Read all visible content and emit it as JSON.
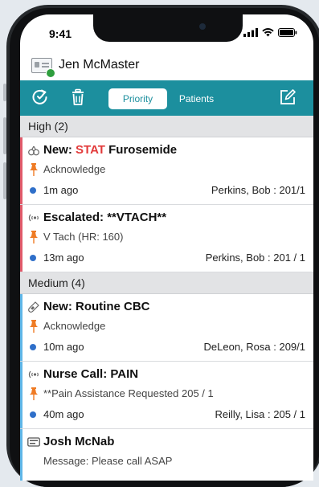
{
  "status": {
    "time": "9:41"
  },
  "user": {
    "name": "Jen McMaster"
  },
  "toolbar": {
    "tab_priority": "Priority",
    "tab_patients": "Patients"
  },
  "sections": [
    {
      "label": "High (2)"
    },
    {
      "label": "Medium (4)"
    }
  ],
  "items": [
    {
      "title_prefix": "New: ",
      "title_highlight": "STAT",
      "title_rest": " Furosemide",
      "subtitle": "Acknowledge",
      "time": "1m ago",
      "patient": "Perkins, Bob : 201/1",
      "icon": "lab-flask-icon"
    },
    {
      "title": "Escalated: **VTACH**",
      "subtitle": "V Tach (HR: 160)",
      "time": "13m ago",
      "patient": "Perkins, Bob : 201 / 1",
      "icon": "alarm-signal-icon"
    },
    {
      "title": "New: Routine CBC",
      "subtitle": "Acknowledge",
      "time": "10m ago",
      "patient": "DeLeon, Rosa : 209/1",
      "icon": "test-tube-icon"
    },
    {
      "title": "Nurse Call: PAIN",
      "subtitle": "**Pain Assistance Requested 205 / 1",
      "time": "40m ago",
      "patient": "Reilly, Lisa : 205 / 1",
      "icon": "alarm-signal-icon"
    },
    {
      "title": "Josh McNab",
      "subtitle": "Message: Please call ASAP",
      "icon": "message-card-icon"
    }
  ],
  "colors": {
    "toolbar": "#1c8f9e",
    "high_priority": "#e05a6a",
    "medium_priority": "#5fb6e8",
    "pin": "#ef7b24",
    "stat": "#e23a3a",
    "dot": "#2f6fc9",
    "online": "#2e9e3e"
  }
}
